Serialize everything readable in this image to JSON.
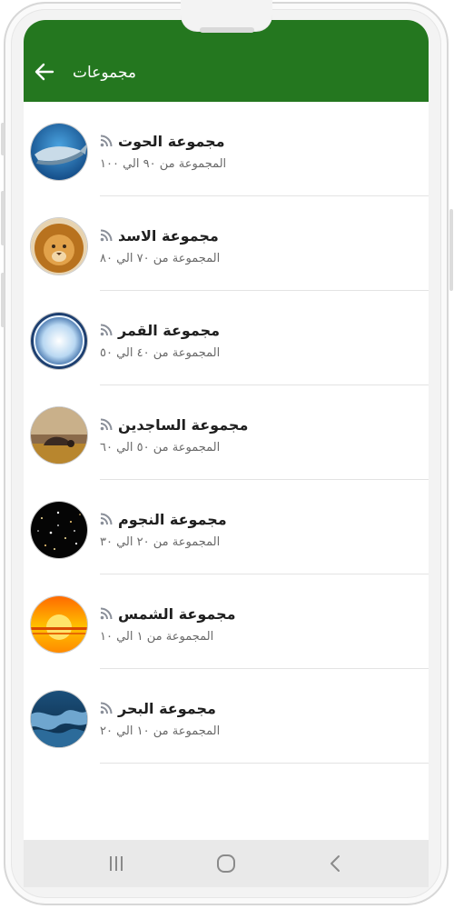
{
  "app_bar": {
    "title": "مجموعات",
    "back_icon": "arrow-back-icon",
    "background_color": "#24771f"
  },
  "groups": [
    {
      "title": "مجموعة الحوت",
      "subtitle": "المجموعة من ٩٠ الي ١٠٠",
      "avatar": "whale-image",
      "status_icon": "rss-feed-icon"
    },
    {
      "title": "مجموعة الاسد",
      "subtitle": "المجموعة من ٧٠ الي ٨٠",
      "avatar": "lion-image",
      "status_icon": "rss-feed-icon"
    },
    {
      "title": "مجموعة القمر",
      "subtitle": "المجموعة من ٤٠ الي ٥٠",
      "avatar": "moon-image",
      "status_icon": "rss-feed-icon"
    },
    {
      "title": "مجموعة الساجدين",
      "subtitle": "المجموعة من ٥٠ الي ٦٠",
      "avatar": "prostrating-person-image",
      "status_icon": "rss-feed-icon"
    },
    {
      "title": "مجموعة النجوم",
      "subtitle": "المجموعة من ٢٠ الي ٣٠",
      "avatar": "stars-image",
      "status_icon": "rss-feed-icon"
    },
    {
      "title": "مجموعة الشمس",
      "subtitle": "المجموعة من ١ الي ١٠",
      "avatar": "sunset-image",
      "status_icon": "rss-feed-icon"
    },
    {
      "title": "مجموعة البحر",
      "subtitle": "المجموعة من ١٠ الي ٢٠",
      "avatar": "sea-wave-image",
      "status_icon": "rss-feed-icon"
    }
  ],
  "system_nav": {
    "recents_icon": "recents-icon",
    "home_icon": "home-circle-icon",
    "back_icon": "chevron-left-icon"
  }
}
